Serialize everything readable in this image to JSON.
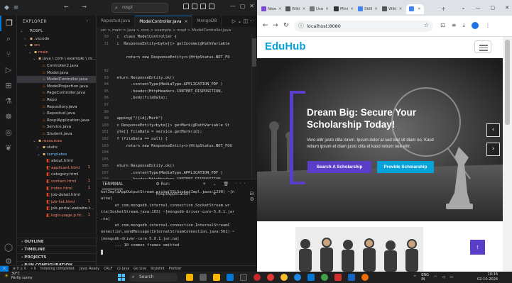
{
  "vscode": {
    "search_text": "rospl",
    "sidebar_title": "EXPLORER",
    "tree": [
      {
        "label": "ROSPL",
        "indent": 0,
        "kind": "root",
        "chev": "⌄"
      },
      {
        "label": ".vscode",
        "indent": 1,
        "kind": "folder",
        "chev": "›"
      },
      {
        "label": "src",
        "indent": 1,
        "kind": "folder",
        "chev": "⌄",
        "color": "red"
      },
      {
        "label": "main",
        "indent": 2,
        "kind": "folder",
        "chev": "⌄",
        "color": "red"
      },
      {
        "label": "java \\ com \\ example \\ ro...",
        "indent": 3,
        "kind": "folder",
        "chev": "⌄"
      },
      {
        "label": "Controller2.java",
        "indent": 4,
        "kind": "java"
      },
      {
        "label": "Model.java",
        "indent": 4,
        "kind": "java"
      },
      {
        "label": "ModelController.java",
        "indent": 4,
        "kind": "java",
        "selected": true
      },
      {
        "label": "ModelProjection.java",
        "indent": 4,
        "kind": "java"
      },
      {
        "label": "PageController.java",
        "indent": 4,
        "kind": "java"
      },
      {
        "label": "Repo",
        "indent": 4,
        "kind": "java"
      },
      {
        "label": "Repository.java",
        "indent": 4,
        "kind": "java"
      },
      {
        "label": "Repostud.java",
        "indent": 4,
        "kind": "java"
      },
      {
        "label": "RospIApplication.java",
        "indent": 4,
        "kind": "java"
      },
      {
        "label": "Service.java",
        "indent": 4,
        "kind": "java"
      },
      {
        "label": "Student.java",
        "indent": 4,
        "kind": "java"
      },
      {
        "label": "resources",
        "indent": 3,
        "kind": "folder",
        "chev": "⌄",
        "color": "red"
      },
      {
        "label": "static",
        "indent": 4,
        "kind": "folder",
        "chev": "›"
      },
      {
        "label": "templates",
        "indent": 4,
        "kind": "folder",
        "chev": "⌄",
        "color": "blue"
      },
      {
        "label": "about.html",
        "indent": 5,
        "kind": "html"
      },
      {
        "label": "applicant.html",
        "indent": 5,
        "kind": "html",
        "color": "red",
        "badge": "1"
      },
      {
        "label": "category.html",
        "indent": 5,
        "kind": "html"
      },
      {
        "label": "contact.html",
        "indent": 5,
        "kind": "html",
        "color": "red",
        "badge": "1"
      },
      {
        "label": "index.html",
        "indent": 5,
        "kind": "html",
        "color": "red",
        "badge": "1"
      },
      {
        "label": "job-detail.html",
        "indent": 5,
        "kind": "html"
      },
      {
        "label": "job-list.html",
        "indent": 5,
        "kind": "html",
        "color": "red",
        "badge": "1"
      },
      {
        "label": "job-portal-website-t...",
        "indent": 5,
        "kind": "html"
      },
      {
        "label": "login-page.p.ht...",
        "indent": 5,
        "kind": "html",
        "color": "red",
        "badge": "1"
      }
    ],
    "sections": [
      "OUTLINE",
      "TIMELINE",
      "PROJECTS",
      "RUN CONFIGURATION"
    ],
    "tabs": [
      {
        "label": "Repostud.java",
        "active": false
      },
      {
        "label": "ModelController.java",
        "active": true
      },
      {
        "label": "MongoDB",
        "active": false
      }
    ],
    "breadcrumb": "src > main > java > com > example > rospl > ModelController.java",
    "code_lines": [
      {
        "n": "30",
        "t": "  c  class ModelController {"
      },
      {
        "n": "31",
        "t": "  c  ResponseEntity<byte[]> getIncome(@PathVariable"
      },
      {
        "n": "",
        "t": ""
      },
      {
        "n": "",
        "t": "      return new ResponseEntity<>(HttpStatus.NOT_FO"
      },
      {
        "n": "",
        "t": ""
      },
      {
        "n": "92",
        "t": ""
      },
      {
        "n": "93",
        "t": "  eturn ResponseEntity.ok()"
      },
      {
        "n": "94",
        "t": "        .contentType(MediaType.APPLICATION_PDF )"
      },
      {
        "n": "95",
        "t": "        .header(HttpHeaders.CONTENT_DISPOSITION,"
      },
      {
        "n": "96",
        "t": "        .body(fileData);"
      },
      {
        "n": "97",
        "t": ""
      },
      {
        "n": "98",
        "t": ""
      },
      {
        "n": "99",
        "t": "  apping(\"/{id}/Mark\")"
      },
      {
        "n": "100",
        "t": "  c ResponseEntity<byte[]> getMark(@PathVariable St"
      },
      {
        "n": "101",
        "t": "  yte[] fileData = service.getMark(id);"
      },
      {
        "n": "102",
        "t": "  f (fileData == null) {"
      },
      {
        "n": "103",
        "t": "      return new ResponseEntity<>(HttpStatus.NOT_FOU"
      },
      {
        "n": "104",
        "t": ""
      },
      {
        "n": "105",
        "t": ""
      },
      {
        "n": "106",
        "t": "  eturn ResponseEntity.ok()"
      },
      {
        "n": "107",
        "t": "        .contentType(MediaType.APPLICATION_PDF )"
      },
      {
        "n": "108",
        "t": "        .header(HttpHeaders.CONTENT_DISPOSITION,"
      },
      {
        "n": "109",
        "t": "        .body(fileData);"
      }
    ],
    "terminal_title": "TERMINAL",
    "terminal_task": "Run: RosplApplication",
    "terminal_lines": [
      "ketImpl$AppOutputStream.write(SSLSocketImpl.java:1290) ~[n",
      "aina]",
      "      at com.mongodb.internal.connection.SocketStream.wr",
      "ite(SocketStream.java:103) ~[mongodb-driver-core-5.0.1.jar",
      ":na]",
      "      at com.mongodb.internal.connection.InternalStreamC",
      "onnection.sendMessage(InternalStreamConnection.java:561) ~",
      "[mongodb-driver-core-5.0.1.jar:na]",
      "      ... 10 common frames omitted"
    ],
    "status": [
      "⊗ 0 ⚠ 0",
      "⚡ 0",
      "Indexing completed.",
      "Java: Ready",
      "CRLF",
      "{} Java",
      "Go Live",
      "Stylelint",
      "Prettier"
    ]
  },
  "chrome": {
    "tabs": [
      "New",
      "Wiki",
      "Use",
      "Mini",
      "Skill",
      "Wiki",
      ""
    ],
    "url": "localhost:8080",
    "site": {
      "logo": "EduHub",
      "hero_title": "Dream Big: Secure Your Scholarship Today!",
      "hero_text": "Vero elitr justo clita lorem. Ipsum dolor at sed stet sit diam no. Kasd rebum ipsum et diam justo clita et kasd rebum sea elitr.",
      "btn_primary": "Search A Scholarship",
      "btn_secondary": "Provide Scholarship",
      "prev_icon": "‹",
      "next_icon": "›",
      "back_top_icon": "↑"
    }
  },
  "taskbar": {
    "temp": "30°C",
    "weather": "Partly sunny",
    "search": "Search",
    "lang": "ENG",
    "region": "IN",
    "time": "10:16",
    "date": "02-10-2024"
  },
  "colors": {
    "accent": "#5b3ec8",
    "brand": "#06a3da",
    "vscode_blue": "#0078d4"
  }
}
